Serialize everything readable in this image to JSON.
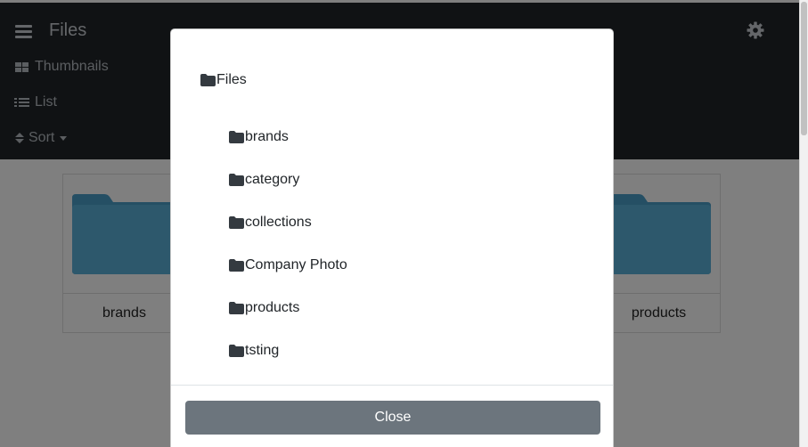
{
  "header": {
    "title": "Files",
    "nav": {
      "thumbnails": "Thumbnails",
      "list": "List",
      "sort": "Sort"
    }
  },
  "gallery": {
    "cards": [
      {
        "label": "brands"
      },
      {
        "label": "products"
      }
    ]
  },
  "modal": {
    "root": "Files",
    "folders": [
      "brands",
      "category",
      "collections",
      "Company Photo",
      "products",
      "tsting"
    ],
    "close_label": "Close"
  },
  "colors": {
    "topbar": "#212529",
    "folder": "#5ab0d9",
    "close_button": "#6c757d"
  }
}
